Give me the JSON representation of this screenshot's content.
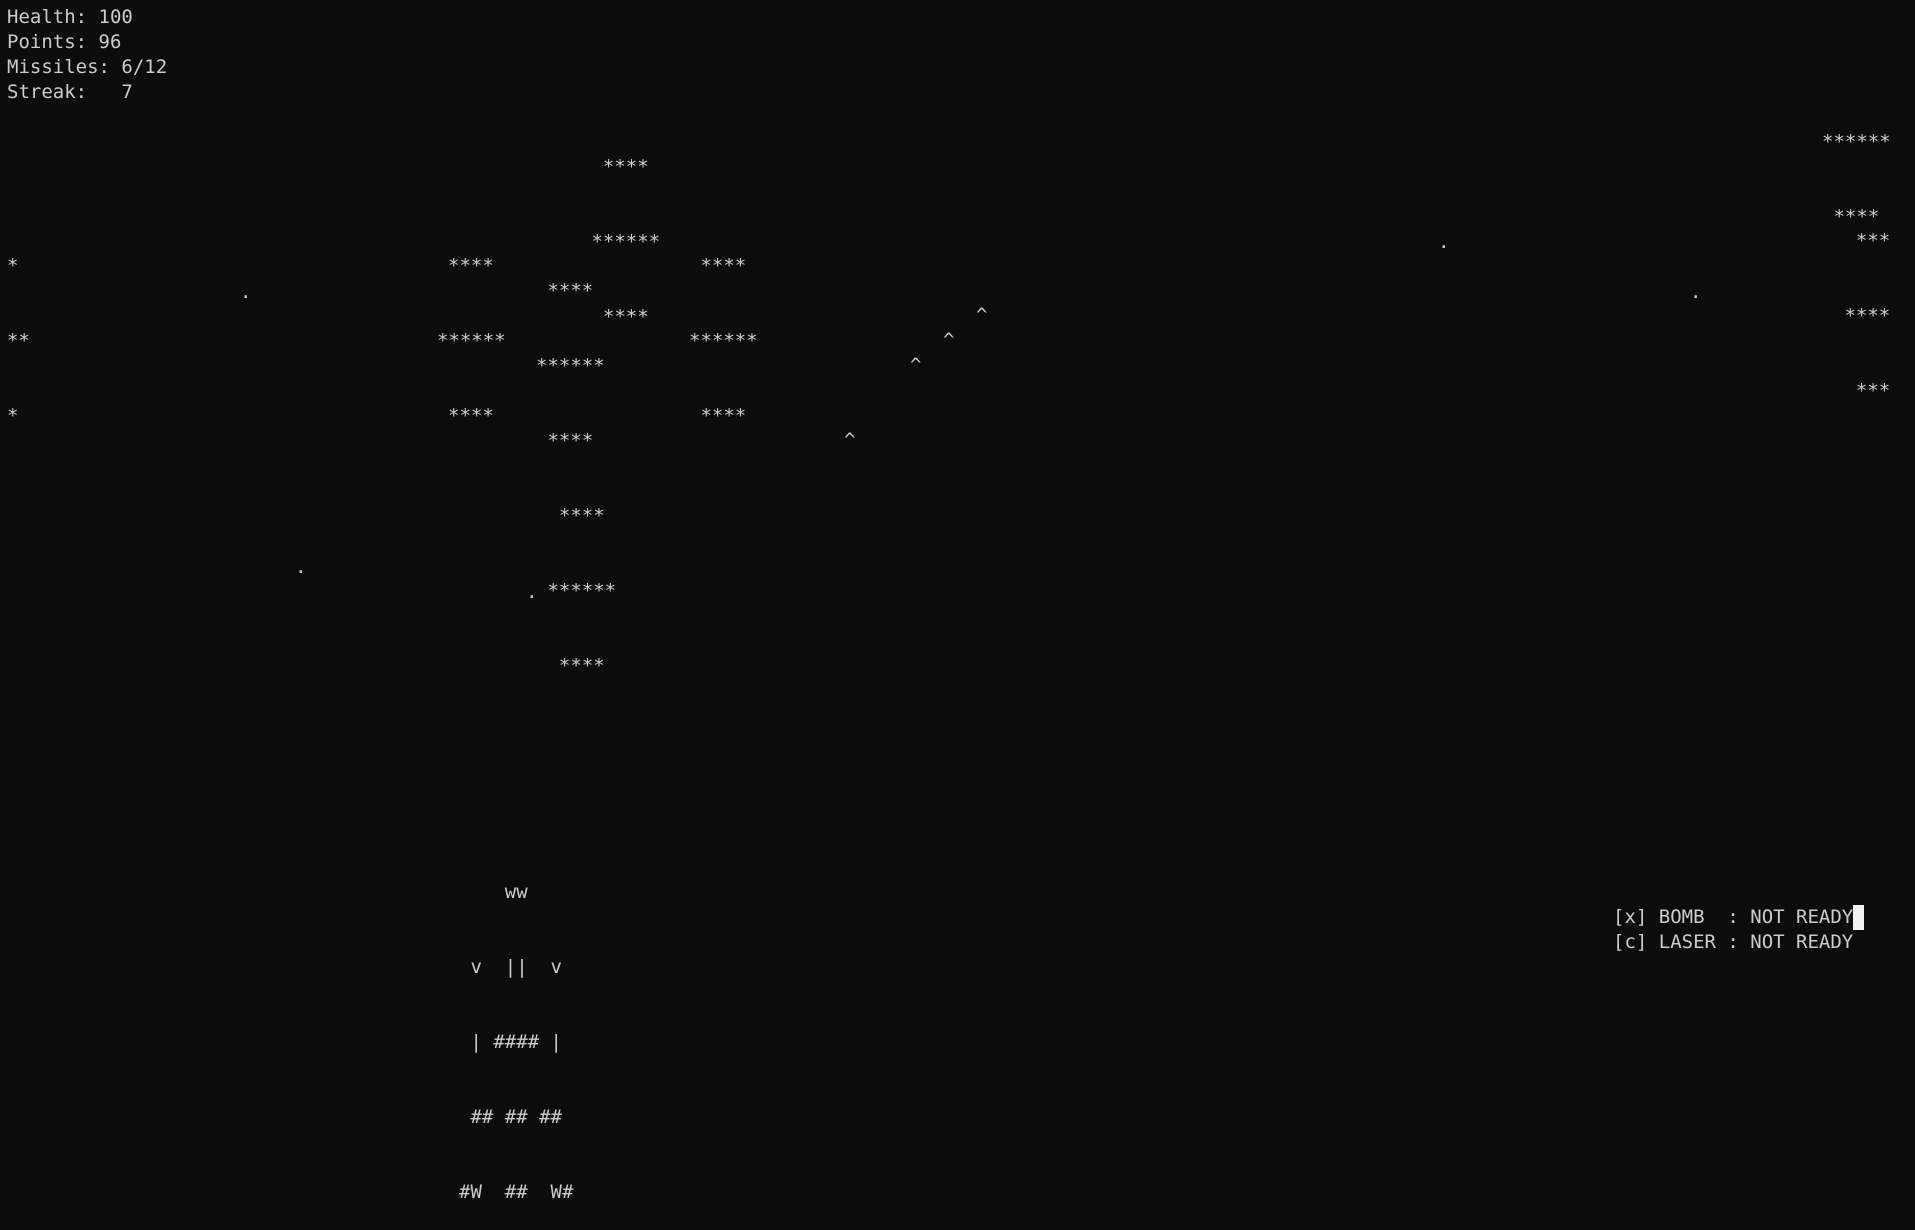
{
  "hud": {
    "health": "Health: 100",
    "points": "Points: 96",
    "missiles": "Missiles: 6/12",
    "streak": "Streak:   7"
  },
  "enemies": [
    {
      "name": "enemy-top-center",
      "lines": [
        "  ****",
        " ******",
        "  ****"
      ]
    },
    {
      "name": "enemy-left",
      "lines": [
        "****",
        "******",
        "****"
      ]
    },
    {
      "name": "enemy-mid-cross",
      "lines": [
        " ****",
        "******",
        " ****",
        "  ****",
        " ******",
        "  ****"
      ]
    },
    {
      "name": "enemy-right-center",
      "lines": [
        " ****",
        "******",
        " ****"
      ]
    },
    {
      "name": "enemy-far-right-top",
      "lines": [
        "******",
        " ****"
      ]
    },
    {
      "name": "enemy-far-right",
      "lines": [
        "  ***",
        " ****",
        "  ***"
      ]
    },
    {
      "name": "enemy-far-left",
      "lines": [
        "*",
        "**",
        "*"
      ]
    }
  ],
  "missiles_in_flight": [
    "^",
    "^",
    "^",
    "^"
  ],
  "stars": [
    ".",
    ".",
    ".",
    ".",
    ".",
    "."
  ],
  "player_ship": {
    "lines": [
      "    ww",
      " v  ||  v",
      " | #### |",
      " ## ## ##",
      "#W  ##  W#"
    ]
  },
  "abilities": {
    "bomb": "[x] BOMB  : NOT READY",
    "laser": "[c] LASER : NOT READY"
  }
}
